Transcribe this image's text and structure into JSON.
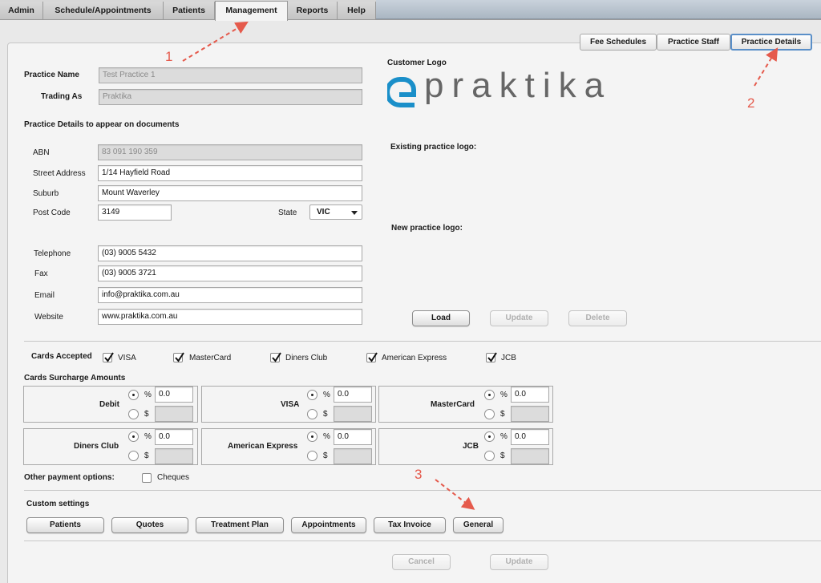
{
  "nav": {
    "tabs": [
      {
        "label": "Admin"
      },
      {
        "label": "Schedule/Appointments"
      },
      {
        "label": "Patients"
      },
      {
        "label": "Management"
      },
      {
        "label": "Reports"
      },
      {
        "label": "Help"
      }
    ],
    "active": "Management"
  },
  "subtabs": [
    {
      "label": "Fee Schedules"
    },
    {
      "label": "Practice Staff"
    },
    {
      "label": "Practice Details"
    }
  ],
  "practice": {
    "name_label": "Practice Name",
    "name_value": "Test Practice 1",
    "trading_label": "Trading As",
    "trading_value": "Praktika",
    "details_heading": "Practice Details to appear on documents"
  },
  "fields": {
    "abn_label": "ABN",
    "abn_value": "83 091 190 359",
    "street_label": "Street Address",
    "street_value": "1/14 Hayfield Road",
    "suburb_label": "Suburb",
    "suburb_value": "Mount Waverley",
    "postcode_label": "Post Code",
    "postcode_value": "3149",
    "state_label": "State",
    "state_value": "VIC",
    "telephone_label": "Telephone",
    "telephone_value": "(03) 9005 5432",
    "fax_label": "Fax",
    "fax_value": "(03) 9005 3721",
    "email_label": "Email",
    "email_value": "info@praktika.com.au",
    "website_label": "Website",
    "website_value": "www.praktika.com.au"
  },
  "logo": {
    "customer_logo_label": "Customer Logo",
    "wordmark": "praktika",
    "existing_label": "Existing practice logo:",
    "new_label": "New practice logo:",
    "load": "Load",
    "update": "Update",
    "delete": "Delete",
    "brand_color": "#1a8fc9"
  },
  "cards": {
    "accepted_label": "Cards Accepted",
    "items": [
      {
        "label": "VISA",
        "checked": true
      },
      {
        "label": "MasterCard",
        "checked": true
      },
      {
        "label": "Diners Club",
        "checked": true
      },
      {
        "label": "American Express",
        "checked": true
      },
      {
        "label": "JCB",
        "checked": true
      }
    ],
    "surcharge_label": "Cards Surcharge Amounts",
    "surcharges": [
      {
        "name": "Debit",
        "percent_symbol": "%",
        "dollar_symbol": "$",
        "percent_value": "0.0"
      },
      {
        "name": "VISA",
        "percent_symbol": "%",
        "dollar_symbol": "$",
        "percent_value": "0.0"
      },
      {
        "name": "MasterCard",
        "percent_symbol": "%",
        "dollar_symbol": "$",
        "percent_value": "0.0"
      },
      {
        "name": "Diners Club",
        "percent_symbol": "%",
        "dollar_symbol": "$",
        "percent_value": "0.0"
      },
      {
        "name": "American Express",
        "percent_symbol": "%",
        "dollar_symbol": "$",
        "percent_value": "0.0"
      },
      {
        "name": "JCB",
        "percent_symbol": "%",
        "dollar_symbol": "$",
        "percent_value": "0.0"
      }
    ]
  },
  "other_payment": {
    "label": "Other payment options:",
    "cheques_label": "Cheques",
    "cheques_checked": false
  },
  "custom": {
    "label": "Custom settings",
    "buttons": [
      "Patients",
      "Quotes",
      "Treatment Plan",
      "Appointments",
      "Tax Invoice",
      "General"
    ]
  },
  "footer": {
    "cancel": "Cancel",
    "update": "Update"
  },
  "annotations": {
    "one": "1",
    "two": "2",
    "three": "3",
    "color": "#e55a4c"
  }
}
